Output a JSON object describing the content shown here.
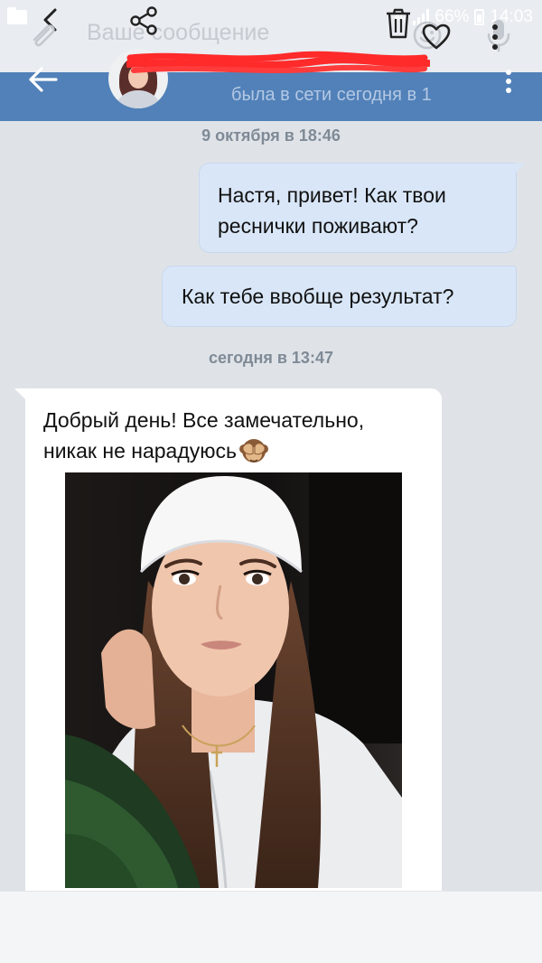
{
  "status_bar": {
    "network": "4G",
    "battery": "66%",
    "time": "14:03"
  },
  "header": {
    "status": "была в сети сегодня в 1"
  },
  "messages": [
    {
      "type": "date",
      "text": "9 октября в 18:46"
    },
    {
      "type": "outgoing",
      "lines": [
        "Настя, привет!  Как твои",
        "реснички поживают?"
      ]
    },
    {
      "type": "outgoing",
      "lines": [
        "Как тебе ввобще результат?"
      ]
    },
    {
      "type": "date",
      "text": "сегодня в 13:47"
    },
    {
      "type": "incoming",
      "lines": [
        "Добрый день! Все замечательно,",
        "никак не нарадуюсь"
      ],
      "emoji": "see-no-evil-monkey"
    }
  ],
  "composer": {
    "placeholder": "Ваше сообщение"
  },
  "colors": {
    "header_blue": "#5181b8",
    "outgoing_bubble": "#d8e6f7",
    "background": "#dfe3e8"
  },
  "icons": [
    "back-arrow-icon",
    "heart-icon",
    "more-vertical-icon",
    "attach-icon",
    "share-icon",
    "delete-icon",
    "emoji-icon",
    "microphone-icon"
  ]
}
